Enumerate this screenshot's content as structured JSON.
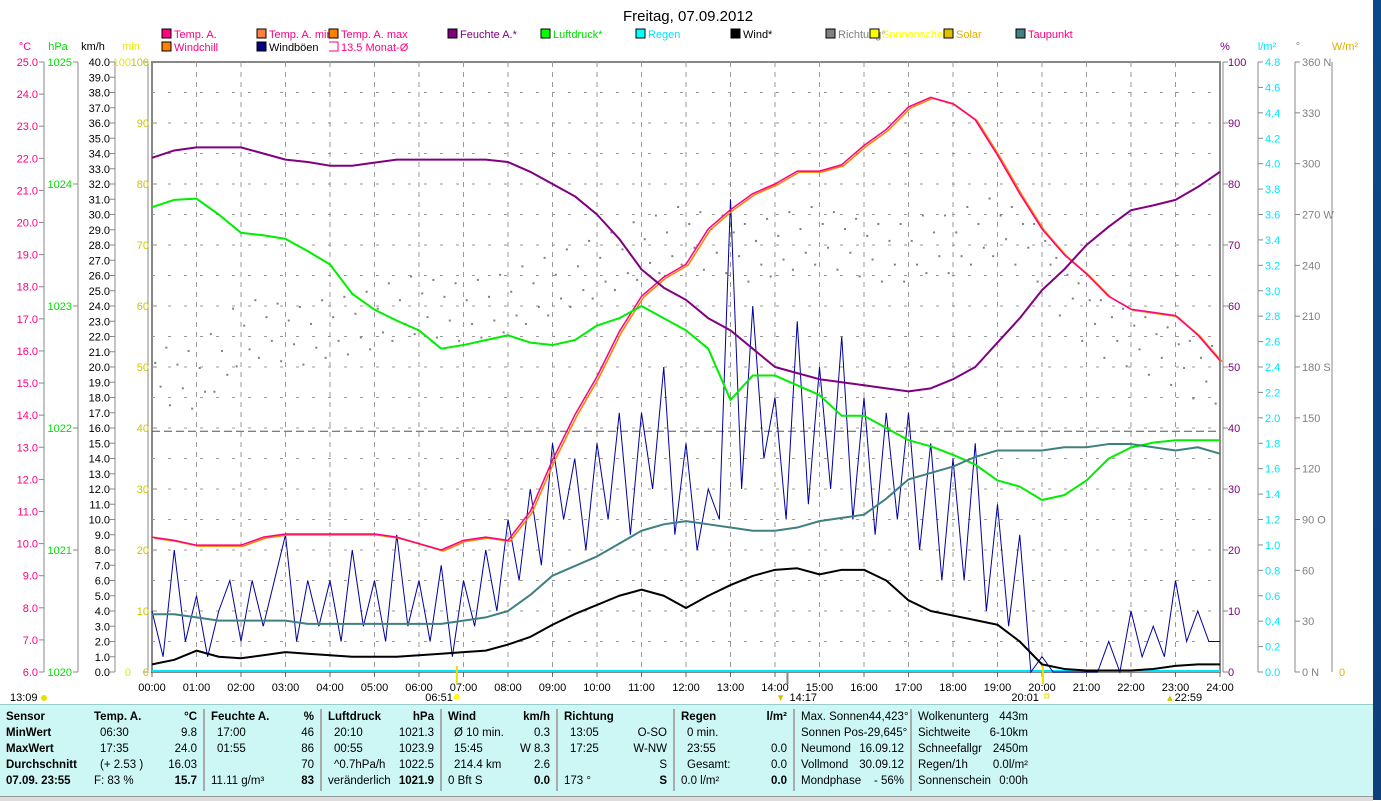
{
  "chart_data": {
    "type": "line",
    "title": "Freitag, 07.09.2012",
    "legend": [
      {
        "label": "Temp. A.",
        "box": "#ff0080",
        "text": "#ff0080"
      },
      {
        "label": "Temp. A. min",
        "box": "#ff8040",
        "text": "#ff0080"
      },
      {
        "label": "Temp. A. max",
        "box": "#ff8000",
        "text": "#ff0080"
      },
      {
        "label": "Feuchte A.*",
        "box": "#800080",
        "text": "#800080"
      },
      {
        "label": "Luftdruck*",
        "box": "#00ff00",
        "text": "#00dd00"
      },
      {
        "label": "Regen",
        "box": "#00ffff",
        "text": "#00e5ff"
      },
      {
        "label": "Wind*",
        "box": "#000000",
        "text": "#000000"
      },
      {
        "label": "Richtung*",
        "box": "#808080",
        "text": "#808080"
      },
      {
        "label": "Sonnenschein",
        "box": "#ffff00",
        "text": "#ffff00"
      },
      {
        "label": "Solar",
        "box": "#e0c000",
        "text": "#e0b000"
      },
      {
        "label": "Taupunkt",
        "box": "#408080",
        "text": "#ff0080"
      },
      {
        "label": "Windchill",
        "box": "#ff8000",
        "text": "#ff0080"
      },
      {
        "label": "Windböen",
        "box": "#000080",
        "text": "#000000"
      },
      {
        "label": "13.5 Monat-Ø",
        "box": "none",
        "text": "#ff0080"
      }
    ],
    "axes": {
      "celsius": {
        "unit": "°C",
        "min": 6,
        "max": 25,
        "step": 1,
        "decimals": 1,
        "color": "#ff0080"
      },
      "hpa": {
        "unit": "hPa",
        "min": 1020,
        "max": 1025,
        "step": 1,
        "decimals": 0,
        "color": "#00dd00"
      },
      "kmh": {
        "unit": "km/h",
        "min": 0,
        "max": 40,
        "step": 1,
        "decimals": 1,
        "color": "#000000"
      },
      "min": {
        "unit": "min",
        "min": 0,
        "max": 100,
        "step": 100,
        "decimals": 0,
        "color": "#e8e800"
      },
      "inner": {
        "min": 0,
        "max": 100,
        "step": 10,
        "decimals": 0,
        "color": "#c8c800"
      },
      "percent": {
        "unit": "%",
        "min": 0,
        "max": 100,
        "step": 10,
        "decimals": 0,
        "color": "#800080"
      },
      "rain": {
        "unit": "l/m²",
        "min": 0,
        "max": 4.8,
        "step": 0.2,
        "decimals": 1,
        "color": "#00e5ff"
      },
      "deg": {
        "unit": "°",
        "min": 0,
        "max": 360,
        "step": 30,
        "decimals": 0,
        "color": "#808080",
        "compass": {
          "0": "N",
          "90": "O",
          "180": "S",
          "270": "W",
          "360": "N"
        }
      },
      "solar": {
        "unit": "W/m²",
        "min": 0,
        "color": "#e0b000"
      }
    },
    "x_labels": [
      "00:00",
      "01:00",
      "02:00",
      "03:00",
      "04:00",
      "05:00",
      "06:00",
      "07:00",
      "08:00",
      "09:00",
      "10:00",
      "11:00",
      "12:00",
      "13:00",
      "14:00",
      "15:00",
      "16:00",
      "17:00",
      "18:00",
      "19:00",
      "20:00",
      "21:00",
      "22:00",
      "23:00",
      "24:00"
    ],
    "x_step_hours": 0.5,
    "month_avg_temp": 13.5,
    "markers": {
      "moonset": "13:09",
      "sunrise": "06:51",
      "sunrise_h": 6.85,
      "sun_max": "14:17",
      "sun_max_h": 14.28,
      "sunset": "20:01",
      "sunset_h": 20.02,
      "moonrise": "22:59",
      "moonrise_h": 22.98
    },
    "series": [
      {
        "name": "Temp. A.",
        "axis": "celsius",
        "color": "#ff0080",
        "values": [
          10.2,
          10.1,
          9.95,
          9.95,
          9.95,
          10.2,
          10.3,
          10.3,
          10.3,
          10.3,
          10.3,
          10.2,
          10.0,
          9.8,
          10.1,
          10.2,
          10.1,
          11.0,
          12.6,
          14.0,
          15.2,
          16.6,
          17.7,
          18.3,
          18.7,
          19.8,
          20.4,
          20.9,
          21.2,
          21.6,
          21.6,
          21.8,
          22.4,
          22.9,
          23.6,
          23.9,
          23.7,
          23.2,
          22.1,
          20.9,
          19.8,
          19.0,
          18.4,
          17.7,
          17.3,
          17.2,
          17.1,
          16.5,
          15.7
        ]
      },
      {
        "name": "Feuchte A.",
        "axis": "percent",
        "color": "#800080",
        "values": [
          84.3,
          85.5,
          86,
          86,
          86,
          85,
          84,
          83.6,
          83,
          83,
          83.5,
          84,
          84,
          84,
          84,
          84,
          83.6,
          82,
          80,
          78,
          75,
          71,
          66,
          63,
          61,
          58,
          56,
          53,
          50,
          49,
          48,
          47.5,
          47,
          46.5,
          46,
          46.5,
          48,
          50,
          54,
          58,
          62.6,
          66,
          70,
          73,
          75.7,
          76.5,
          77.4,
          79.5,
          82
        ]
      },
      {
        "name": "Luftdruck",
        "axis": "hpa",
        "color": "#00ee00",
        "values": [
          1023.81,
          1023.87,
          1023.88,
          1023.75,
          1023.6,
          1023.58,
          1023.55,
          1023.45,
          1023.34,
          1023.1,
          1022.97,
          1022.88,
          1022.8,
          1022.65,
          1022.68,
          1022.72,
          1022.76,
          1022.7,
          1022.68,
          1022.72,
          1022.84,
          1022.9,
          1023.0,
          1022.9,
          1022.8,
          1022.65,
          1022.23,
          1022.43,
          1022.43,
          1022.35,
          1022.27,
          1022.1,
          1022.1,
          1022.0,
          1021.9,
          1021.85,
          1021.78,
          1021.7,
          1021.57,
          1021.52,
          1021.41,
          1021.45,
          1021.57,
          1021.75,
          1021.84,
          1021.88,
          1021.9,
          1021.9,
          1021.9
        ]
      },
      {
        "name": "Taupunkt",
        "axis": "celsius",
        "color": "#408080",
        "values": [
          7.8,
          7.8,
          7.7,
          7.6,
          7.6,
          7.6,
          7.6,
          7.5,
          7.5,
          7.5,
          7.5,
          7.5,
          7.5,
          7.5,
          7.6,
          7.7,
          7.9,
          8.4,
          9.0,
          9.3,
          9.6,
          10.0,
          10.4,
          10.6,
          10.7,
          10.6,
          10.5,
          10.4,
          10.4,
          10.5,
          10.7,
          10.8,
          10.9,
          11.4,
          12.0,
          12.2,
          12.4,
          12.7,
          12.9,
          12.9,
          12.9,
          13.0,
          13.0,
          13.1,
          13.1,
          13.0,
          12.9,
          13.0,
          12.8
        ]
      },
      {
        "name": "Wind",
        "axis": "kmh",
        "color": "#000000",
        "values": [
          0.5,
          0.8,
          1.4,
          1.0,
          0.9,
          1.1,
          1.3,
          1.2,
          1.1,
          1.0,
          1.0,
          1.0,
          1.1,
          1.2,
          1.3,
          1.4,
          1.8,
          2.3,
          3.1,
          3.8,
          4.4,
          5.0,
          5.4,
          5.0,
          4.2,
          5.0,
          5.7,
          6.3,
          6.7,
          6.8,
          6.4,
          6.7,
          6.7,
          6.0,
          4.7,
          4.0,
          3.7,
          3.4,
          3.1,
          2.0,
          0.5,
          0.2,
          0.1,
          0.1,
          0.1,
          0.2,
          0.4,
          0.5,
          0.5
        ]
      }
    ],
    "gusts": {
      "name": "Windböen",
      "axis": "kmh",
      "color": "#0000a0",
      "step_hours": 0.25,
      "values": [
        4,
        1,
        8,
        2,
        5,
        1,
        4,
        6,
        2,
        6,
        3,
        6,
        9,
        2,
        6,
        3,
        6,
        2,
        8,
        3,
        6,
        2,
        9,
        3,
        6,
        2,
        7,
        1,
        6,
        3,
        8,
        4,
        10,
        6,
        12,
        7,
        15,
        10,
        14,
        8,
        15,
        10,
        17,
        9,
        17,
        12,
        20,
        9,
        15,
        8,
        12,
        10,
        31,
        12,
        24,
        14,
        18,
        10,
        23,
        11,
        20,
        12,
        22,
        10,
        18,
        9,
        17,
        10,
        17,
        8,
        15,
        6,
        14,
        6,
        15,
        4,
        11,
        3,
        9,
        0,
        1,
        0,
        0,
        0,
        0,
        0,
        2,
        0,
        4,
        1,
        3,
        1,
        6,
        2,
        4,
        2,
        2
      ]
    },
    "direction": {
      "name": "Richtung",
      "axis": "deg",
      "color": "#808080",
      "values": [
        173,
        172,
        170,
        180,
        195,
        200,
        198,
        196,
        200,
        202,
        205,
        210,
        214,
        212,
        210,
        212,
        215,
        220,
        225,
        230,
        235,
        240,
        246,
        250,
        255,
        252,
        250,
        245,
        248,
        252,
        255,
        252,
        248,
        245,
        245,
        250,
        250,
        255,
        260,
        255,
        245,
        225,
        210,
        200,
        195,
        190,
        184,
        176,
        173
      ]
    }
  },
  "table": {
    "sensor": [
      "Sensor",
      "MinWert",
      "MaxWert",
      "Durchschnitt",
      "07.09. 23:55"
    ],
    "temp": {
      "head": "Temp. A.",
      "unit": "°C",
      "rows": [
        [
          "06:30",
          "9.8"
        ],
        [
          "17:35",
          "24.0"
        ],
        [
          "(+ 2.53 )",
          "16.03"
        ],
        [
          "F: 83 %",
          "15.7"
        ]
      ]
    },
    "hum": {
      "head": "Feuchte A.",
      "unit": "%",
      "rows": [
        [
          "17:00",
          "46"
        ],
        [
          "01:55",
          "86"
        ],
        [
          "",
          "70"
        ],
        [
          "11.11 g/m³",
          "83"
        ]
      ]
    },
    "press": {
      "head": "Luftdruck",
      "unit": "hPa",
      "rows": [
        [
          "20:10",
          "1021.3"
        ],
        [
          "00:55",
          "1023.9"
        ],
        [
          "^0.7hPa/h",
          "1022.5"
        ],
        [
          "veränderlich",
          "1021.9"
        ]
      ]
    },
    "wind": {
      "head": "Wind",
      "unit": "km/h",
      "rows": [
        [
          "Ø 10 min.",
          "0.3"
        ],
        [
          "15:45",
          "W 8.3"
        ],
        [
          "214.4 km",
          "2.6"
        ],
        [
          "0 Bft S",
          "0.0"
        ]
      ]
    },
    "dir": {
      "head": "Richtung",
      "unit": "",
      "rows": [
        [
          "13:05",
          "O-SO"
        ],
        [
          "17:25",
          "W-NW"
        ],
        [
          "",
          "S"
        ],
        [
          "173 °",
          "S"
        ]
      ]
    },
    "rain": {
      "head": "Regen",
      "unit": "l/m²",
      "rows": [
        [
          "0 min.",
          ""
        ],
        [
          "23:55",
          "0.0"
        ],
        [
          "Gesamt:",
          "0.0"
        ],
        [
          "0.0 l/m²",
          "0.0"
        ]
      ]
    },
    "astro": [
      [
        "Max. Sonnen",
        "44,423°"
      ],
      [
        "Sonnen Pos",
        "-29,645°"
      ],
      [
        "Neumond",
        "16.09.12"
      ],
      [
        "Vollmond",
        "30.09.12"
      ],
      [
        "Mondphase",
        "- 56%"
      ]
    ],
    "misc": [
      [
        "Wolkenunterg",
        "443m"
      ],
      [
        "Sichtweite",
        "6-10km"
      ],
      [
        "Schneefallgr",
        "2450m"
      ],
      [
        "Regen/1h",
        "0.0l/m²"
      ],
      [
        "Sonnenschein",
        "0:00h"
      ]
    ]
  }
}
